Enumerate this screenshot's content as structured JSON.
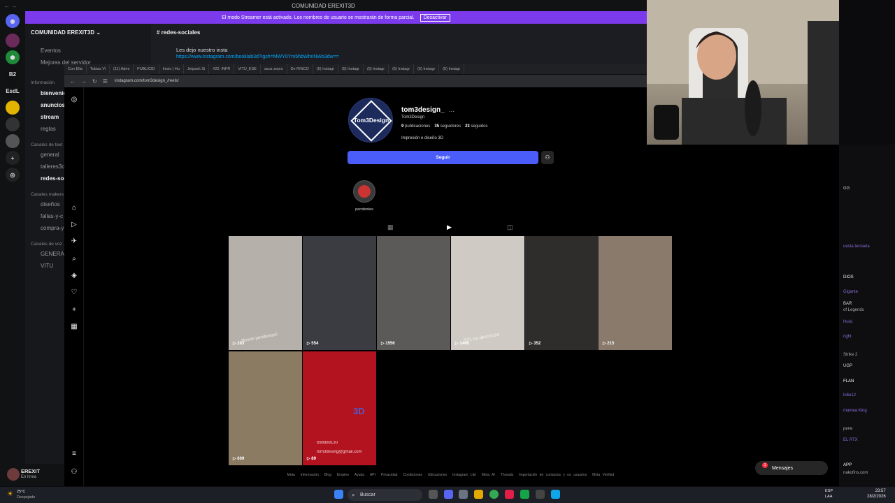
{
  "discord": {
    "window_title": "COMUNIDAD EREXIT3D",
    "banner_text": "El modo Streamer está activado. Los nombres de usuario se mostrarán de forma parcial.",
    "banner_button": "Desactivar",
    "server_name": "COMUNIDAD EREXIT3D",
    "channel_header": "redes-sociales",
    "message": "Les dejo nuestro insta",
    "message_link": "https://www.instagram.com/booklab3d?igsh=MWY0Ym5hbWhnNWo3dw==",
    "server_labels": [
      "B2",
      "EsdL"
    ],
    "sidebar": {
      "top_items": [
        "Eventos",
        "Mejoras del servidor"
      ],
      "cat_info": "Información",
      "info_channels": [
        "bienvenid",
        "anuncios",
        "stream",
        "reglas"
      ],
      "cat_text": "Canales de text",
      "text_channels": [
        "general",
        "talleres3c",
        "redes-soc"
      ],
      "cat_makers": "Canales makers",
      "maker_channels": [
        "diseños",
        "fallas-y-c",
        "compra-y"
      ],
      "cat_voice": "Canales de voz",
      "voice_channels": [
        "GENERAL",
        "VITU"
      ]
    },
    "user": {
      "name": "EREXIT",
      "status": "En línea"
    }
  },
  "browser": {
    "tabs": [
      "Con Ella",
      "Tobias Vi",
      "(11) Admi",
      "PUBLICID",
      "Inicio | Hu",
      "Jetpack Si",
      "#22: INFR",
      "VITU_ESE",
      "asus zeprs",
      "De RINCO",
      "(5) Instagr",
      "(5) Instagr",
      "(5) Instagr",
      "(5) Instagr",
      "(5) Instagr",
      "(5) Instagr"
    ],
    "url": "instagram.com/tom3design_/reels/"
  },
  "instagram": {
    "avatar_text": "Tom3Design",
    "username": "tom3design_",
    "more": "...",
    "full_name": "Tom3Design",
    "stats": [
      {
        "n": "9",
        "l": "publicaciones"
      },
      {
        "n": "35",
        "l": "seguidores"
      },
      {
        "n": "23",
        "l": "seguidos"
      }
    ],
    "bio": "Impresión e diseño 3D",
    "follow": "Seguir",
    "highlight": "pendentes",
    "reels": [
      {
        "views": "283",
        "overlay": "Novos pendentes!",
        "bg": "#b6b0aa"
      },
      {
        "views": "554",
        "overlay": "",
        "bg": "#3a3c42"
      },
      {
        "views": "1556",
        "overlay": "",
        "bg": "#5b5a58"
      },
      {
        "views": "1446",
        "overlay": "STL na descrición",
        "bg": "#cfcac4"
      },
      {
        "views": "352",
        "overlay": "",
        "bg": "#2e2d2c"
      },
      {
        "views": "215",
        "overlay": "",
        "bg": "#8a7a6c"
      },
      {
        "views": "609",
        "overlay": "",
        "bg": "#8b7b62"
      },
      {
        "views": "89",
        "overlay": "3D",
        "bg": "#b3121f",
        "phone": "698989130",
        "email": "tom3desing@gmail.com"
      }
    ],
    "footer": [
      "Meta",
      "Información",
      "Blog",
      "Empleo",
      "Ayuda",
      "API",
      "Privacidad",
      "Condiciones",
      "Ubicaciones",
      "Instagram Lite",
      "Meta AI",
      "Threads",
      "Importación de contactos y no usuarios",
      "Meta Verified"
    ],
    "messages": "Mensajes",
    "messages_badge": "1"
  },
  "chat": {
    "lines": [
      {
        "t": "GG",
        "c": "#ccc"
      },
      {
        "t": "uesta terciaria",
        "c": "#8a6dd8"
      },
      {
        "t": "DIOS",
        "c": "#eee"
      },
      {
        "t": "Gigante",
        "c": "#8a6dd8"
      },
      {
        "t": "BAR",
        "c": "#ddd"
      },
      {
        "t": "of Legends",
        "c": "#aaa"
      },
      {
        "t": "Huisi",
        "c": "#8a6dd8"
      },
      {
        "t": "right",
        "c": "#8a6dd8"
      },
      {
        "t": "Strike 2",
        "c": "#aaa"
      },
      {
        "t": "UGP",
        "c": "#ddd"
      },
      {
        "t": "FLAN",
        "c": "#fff"
      },
      {
        "t": "lo6e12",
        "c": "#8a6dd8"
      },
      {
        "t": "mamea King",
        "c": "#8a6dd8"
      },
      {
        "t": "pene",
        "c": "#aaa"
      },
      {
        "t": "EL RTX",
        "c": "#8a6dd8"
      },
      {
        "t": "APP",
        "c": "#fff"
      },
      {
        "t": "nakofins.com",
        "c": "#aaa"
      }
    ]
  },
  "taskbar": {
    "weather_temp": "25°C",
    "weather_desc": "Despejado",
    "search": "Buscar",
    "lang1": "ESP",
    "lang2": "LAA",
    "time": "23:57",
    "date": "28/2/2026"
  },
  "colors": {
    "accent": "#4a5df9",
    "banner": "#7c3aed",
    "link": "#00a8fc"
  }
}
